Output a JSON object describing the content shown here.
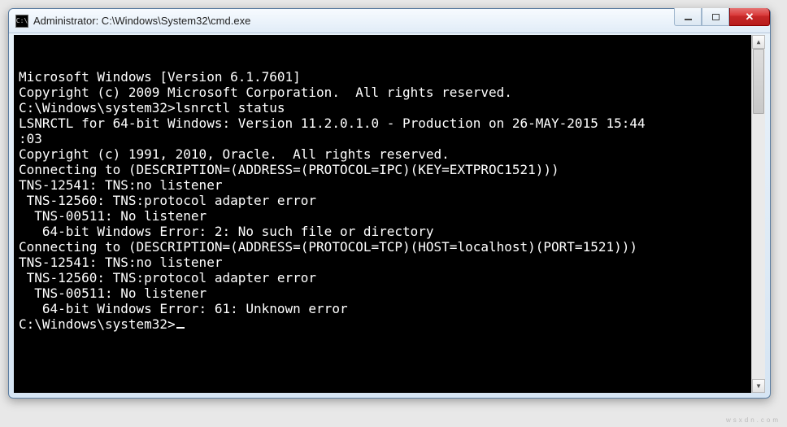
{
  "window": {
    "title": "Administrator: C:\\Windows\\System32\\cmd.exe",
    "icon_label": "C:\\"
  },
  "terminal": {
    "lines": [
      "Microsoft Windows [Version 6.1.7601]",
      "Copyright (c) 2009 Microsoft Corporation.  All rights reserved.",
      "",
      "C:\\Windows\\system32>lsnrctl status",
      "",
      "LSNRCTL for 64-bit Windows: Version 11.2.0.1.0 - Production on 26-MAY-2015 15:44",
      ":03",
      "",
      "Copyright (c) 1991, 2010, Oracle.  All rights reserved.",
      "",
      "Connecting to (DESCRIPTION=(ADDRESS=(PROTOCOL=IPC)(KEY=EXTPROC1521)))",
      "TNS-12541: TNS:no listener",
      " TNS-12560: TNS:protocol adapter error",
      "  TNS-00511: No listener",
      "   64-bit Windows Error: 2: No such file or directory",
      "Connecting to (DESCRIPTION=(ADDRESS=(PROTOCOL=TCP)(HOST=localhost)(PORT=1521)))",
      "TNS-12541: TNS:no listener",
      " TNS-12560: TNS:protocol adapter error",
      "  TNS-00511: No listener",
      "   64-bit Windows Error: 61: Unknown error",
      "",
      "C:\\Windows\\system32>"
    ]
  },
  "watermark": {
    "main": "",
    "sub": "wsxdn.com"
  }
}
